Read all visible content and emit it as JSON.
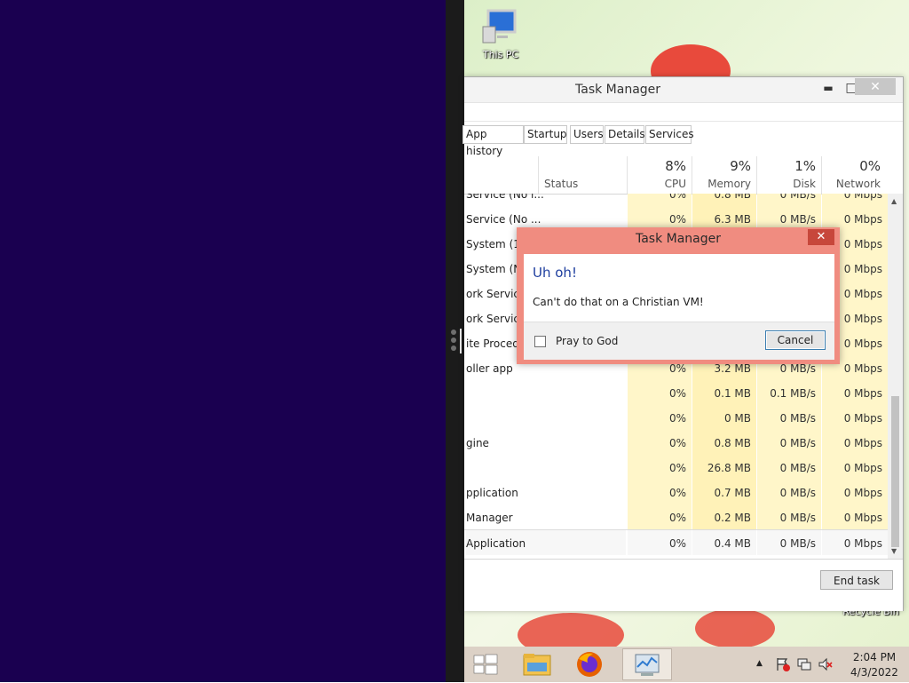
{
  "desktop": {
    "this_pc_label": "This PC",
    "recycle_bin_label": "Recycle Bin"
  },
  "task_manager": {
    "title": "Task Manager",
    "minimize": "▬",
    "maximize": "□",
    "close": "✕",
    "tabs": [
      "App history",
      "Startup",
      "Users",
      "Details",
      "Services"
    ],
    "columns": {
      "status": "Status",
      "cpu": {
        "pct": "8%",
        "name": "CPU"
      },
      "memory": {
        "pct": "9%",
        "name": "Memory"
      },
      "disk": {
        "pct": "1%",
        "name": "Disk"
      },
      "network": {
        "pct": "0%",
        "name": "Network"
      }
    },
    "rows": [
      {
        "name": "Service (No l...",
        "cpu": "0%",
        "mem": "0.8 MB",
        "disk": "0 MB/s",
        "net": "0 Mbps"
      },
      {
        "name": "Service (No ...",
        "cpu": "0%",
        "mem": "6.3 MB",
        "disk": "0 MB/s",
        "net": "0 Mbps"
      },
      {
        "name": "System (16",
        "cpu": "",
        "mem": "",
        "disk": "",
        "net": "0 Mbps"
      },
      {
        "name": "System (Ne",
        "cpu": "",
        "mem": "",
        "disk": "",
        "net": "0 Mbps"
      },
      {
        "name": "ork Service",
        "cpu": "",
        "mem": "",
        "disk": "",
        "net": "0 Mbps"
      },
      {
        "name": "ork Service",
        "cpu": "",
        "mem": "",
        "disk": "",
        "net": "0 Mbps"
      },
      {
        "name": "ite Procedu",
        "cpu": "",
        "mem": "",
        "disk": "",
        "net": "0 Mbps"
      },
      {
        "name": "oller app",
        "cpu": "0%",
        "mem": "3.2 MB",
        "disk": "0 MB/s",
        "net": "0 Mbps"
      },
      {
        "name": "",
        "cpu": "0%",
        "mem": "0.1 MB",
        "disk": "0.1 MB/s",
        "net": "0 Mbps"
      },
      {
        "name": "",
        "cpu": "0%",
        "mem": "0 MB",
        "disk": "0 MB/s",
        "net": "0 Mbps"
      },
      {
        "name": "gine",
        "cpu": "0%",
        "mem": "0.8 MB",
        "disk": "0 MB/s",
        "net": "0 Mbps"
      },
      {
        "name": "",
        "cpu": "0%",
        "mem": "26.8 MB",
        "disk": "0 MB/s",
        "net": "0 Mbps"
      },
      {
        "name": "pplication",
        "cpu": "0%",
        "mem": "0.7 MB",
        "disk": "0 MB/s",
        "net": "0 Mbps"
      },
      {
        "name": "Manager",
        "cpu": "0%",
        "mem": "0.2 MB",
        "disk": "0 MB/s",
        "net": "0 Mbps"
      },
      {
        "name": "Application",
        "cpu": "0%",
        "mem": "0.4 MB",
        "disk": "0 MB/s",
        "net": "0 Mbps"
      }
    ],
    "end_task_label": "End task"
  },
  "dialog": {
    "title": "Task Manager",
    "close": "✕",
    "heading": "Uh oh!",
    "message": "Can't do that on a Christian VM!",
    "checkbox_label": "Pray to God",
    "checkbox_checked": false,
    "cancel_label": "Cancel"
  },
  "taskbar": {
    "items": [
      "start-icon",
      "file-explorer-icon",
      "firefox-icon",
      "task-manager-icon"
    ],
    "active_item": "task-manager-icon",
    "tray_chevron": "▲",
    "time": "2:04 PM",
    "date": "4/3/2022"
  },
  "colors": {
    "left_pane": "#1a0050",
    "dialog_border": "#f08c80",
    "dialog_heading": "#1f3f9f",
    "taskbar": "#dcd1c6"
  }
}
